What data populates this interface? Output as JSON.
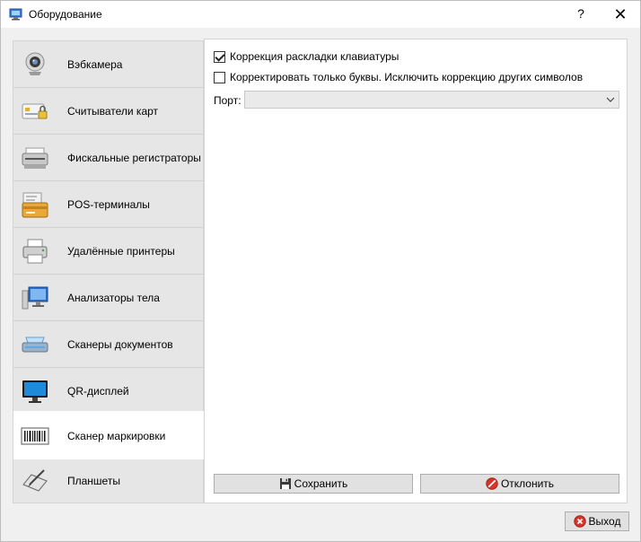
{
  "window": {
    "title": "Оборудование",
    "help_label": "?",
    "close_label": "✕"
  },
  "sidebar": {
    "items": [
      {
        "label": "Вэбкамера",
        "icon": "webcam-icon"
      },
      {
        "label": "Считыватели карт",
        "icon": "card-reader-icon"
      },
      {
        "label": "Фискальные регистраторы",
        "icon": "fiscal-printer-icon"
      },
      {
        "label": "POS-терминалы",
        "icon": "pos-terminal-icon"
      },
      {
        "label": "Удалённые принтеры",
        "icon": "printer-icon"
      },
      {
        "label": "Анализаторы тела",
        "icon": "body-analyzer-icon"
      },
      {
        "label": "Сканеры документов",
        "icon": "document-scanner-icon"
      },
      {
        "label": "QR-дисплей",
        "icon": "monitor-icon"
      },
      {
        "label": "Сканер маркировки",
        "icon": "barcode-icon",
        "active": true
      },
      {
        "label": "Планшеты",
        "icon": "tablet-icon"
      }
    ]
  },
  "settings": {
    "keyboard_layout_correction": {
      "label": "Коррекция раскладки клавиатуры",
      "checked": true
    },
    "letters_only": {
      "label": "Корректировать только буквы. Исключить коррекцию других символов",
      "checked": false
    },
    "port": {
      "label": "Порт:",
      "value": ""
    }
  },
  "buttons": {
    "save": "Сохранить",
    "reject": "Отклонить",
    "exit": "Выход"
  },
  "colors": {
    "window_bg": "#f0f0f0",
    "panel_bg": "#ffffff",
    "sidebar_bg": "#e6e6e6",
    "reject_icon": "#d9342b",
    "exit_icon": "#d9342b"
  }
}
